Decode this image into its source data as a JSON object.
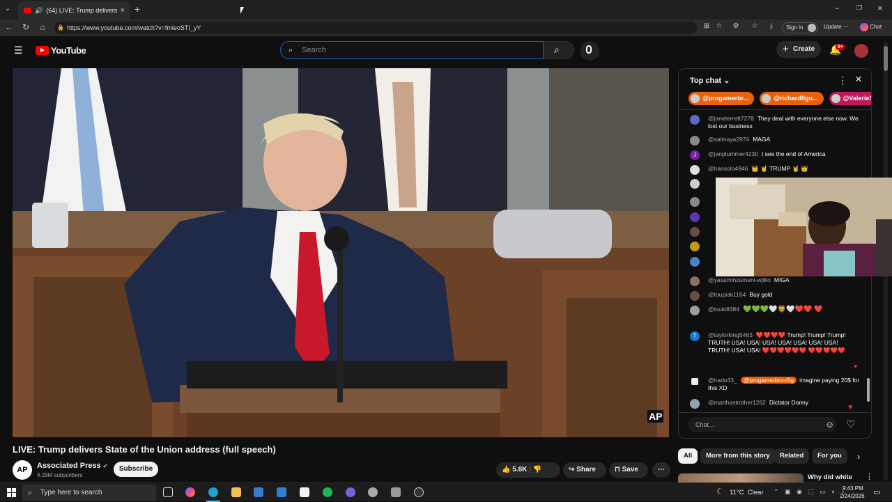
{
  "browser": {
    "tab_title": "(64) LIVE: Trump delivers State of the Union address (full speech)",
    "url": "https://www.youtube.com/watch?v=fmieoSTI_yY",
    "sign_in": "Sign in",
    "update": "Update",
    "chat": "Chat"
  },
  "youtube": {
    "logo": "YouTube",
    "search_placeholder": "Search",
    "create": "Create",
    "notif_count": "9+"
  },
  "video": {
    "title": "LIVE: Trump delivers State of the Union address (full speech)",
    "watermark": "AP"
  },
  "channel": {
    "logo": "AP",
    "name": "Associated Press",
    "subscribers": "4.29M subscribers",
    "subscribe": "Subscribe"
  },
  "actions": {
    "likes": "5.6K",
    "share": "Share",
    "save": "Save"
  },
  "chat": {
    "header": "Top chat",
    "tickers": [
      "@progamerbr...",
      "@richardfigu...",
      "@ValerieS"
    ],
    "input_placeholder": "Chat...",
    "messages": [
      {
        "author": "@janeterrett7278",
        "text": "They deal with everyone else now. We lost our business",
        "avatar": "",
        "color": "#5c6bc0"
      },
      {
        "author": "@salmaya2974",
        "text": "MAGA",
        "avatar": "",
        "color": "#888888"
      },
      {
        "author": "@janplummer4230",
        "text": "I see the end of America",
        "avatar": "J",
        "color": "#7b1fa2"
      },
      {
        "author": "@hansolo4946",
        "text": "👑 🤘 TRUMP 🤘 👑",
        "avatar": "",
        "color": "#dddddd"
      },
      {
        "author": "@yasaminzamani-wj8io",
        "text": "MIGA",
        "avatar": "",
        "color": "#8d6e63"
      },
      {
        "author": "@toupiak1164",
        "text": "Buy gold",
        "avatar": "",
        "color": "#6d4c41"
      },
      {
        "author": "@tsuki8384",
        "text": "💚💚💚🤍🦁🤍❤️❤️ ❤️",
        "avatar": "",
        "color": "#9e9e9e"
      },
      {
        "author": "@taylorking5463",
        "text": "❤️❤️❤️❤️ Trump! Trump! Trump! TRUTH! USA! USA! USA! USA! USA! USA! USA! TRUTH! USA! USA! ❤️❤️❤️❤️❤️❤️ ❤️❤️❤️❤️❤️",
        "avatar": "T",
        "color": "#1976d2"
      },
      {
        "author": "@hado33_",
        "mention": "@progamerbro-r5g",
        "text": "imagine paying 20$ for this XD",
        "avatar": "",
        "color": "#eeeeee"
      },
      {
        "author": "@marthastrother1262",
        "text": "Dictator Donny",
        "avatar": "",
        "color": "#90a4ae"
      }
    ]
  },
  "chips": [
    "All",
    "More from this story",
    "Related",
    "For you"
  ],
  "related_title": "Why did white",
  "taskbar": {
    "search_placeholder": "Type here to search",
    "weather": "11°C  Clear",
    "time": "9:43 PM",
    "date": "2/24/2026"
  },
  "colors": {
    "accent_red": "#ff0000",
    "ticker_orange": "#e8610f",
    "search_border": "#1c62b9"
  }
}
